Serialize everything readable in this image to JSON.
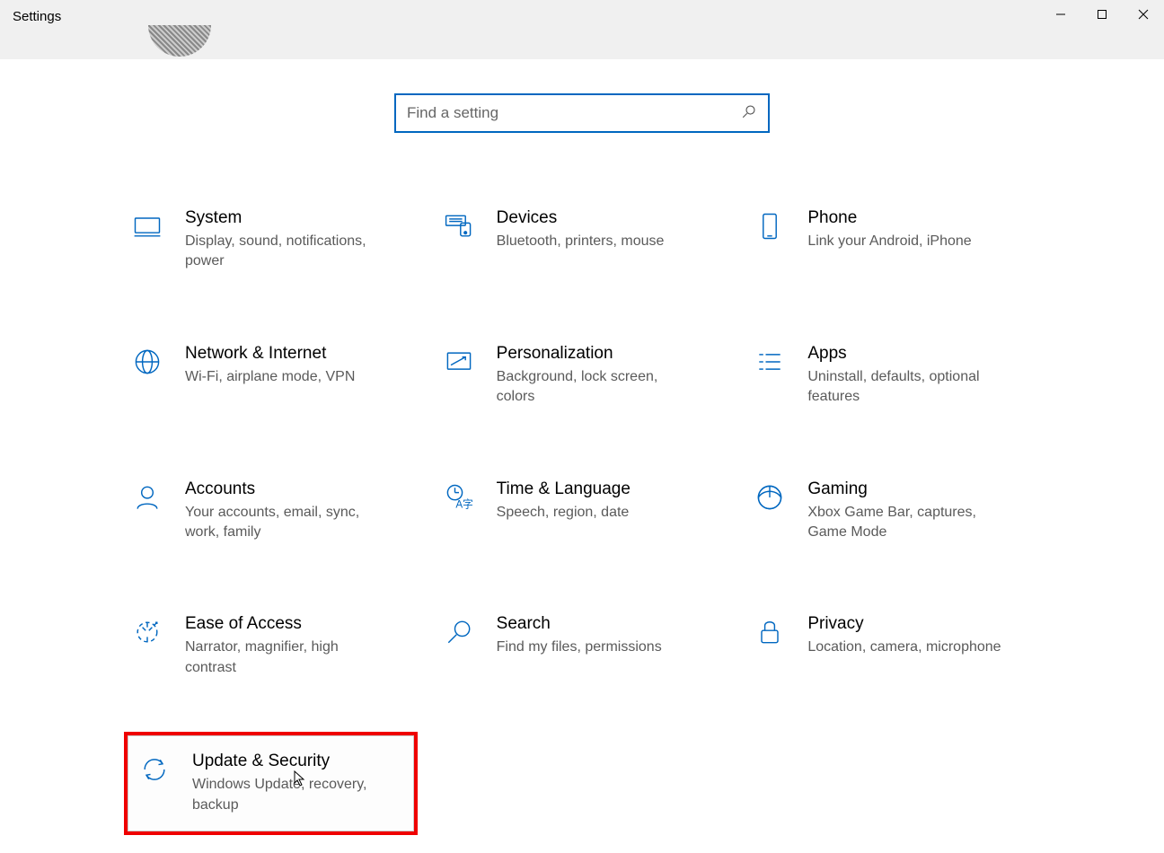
{
  "window": {
    "title": "Settings",
    "minimize": "—",
    "maximize": "☐",
    "close": "✕"
  },
  "search": {
    "placeholder": "Find a setting"
  },
  "categories": [
    {
      "icon": "system",
      "title": "System",
      "desc": "Display, sound, notifications, power"
    },
    {
      "icon": "devices",
      "title": "Devices",
      "desc": "Bluetooth, printers, mouse"
    },
    {
      "icon": "phone",
      "title": "Phone",
      "desc": "Link your Android, iPhone"
    },
    {
      "icon": "network",
      "title": "Network & Internet",
      "desc": "Wi-Fi, airplane mode, VPN"
    },
    {
      "icon": "personal",
      "title": "Personalization",
      "desc": "Background, lock screen, colors"
    },
    {
      "icon": "apps",
      "title": "Apps",
      "desc": "Uninstall, defaults, optional features"
    },
    {
      "icon": "accounts",
      "title": "Accounts",
      "desc": "Your accounts, email, sync, work, family"
    },
    {
      "icon": "time",
      "title": "Time & Language",
      "desc": "Speech, region, date"
    },
    {
      "icon": "gaming",
      "title": "Gaming",
      "desc": "Xbox Game Bar, captures, Game Mode"
    },
    {
      "icon": "ease",
      "title": "Ease of Access",
      "desc": "Narrator, magnifier, high contrast"
    },
    {
      "icon": "search",
      "title": "Search",
      "desc": "Find my files, permissions"
    },
    {
      "icon": "privacy",
      "title": "Privacy",
      "desc": "Location, camera, microphone"
    },
    {
      "icon": "update",
      "title": "Update & Security",
      "desc": "Windows Update, recovery, backup",
      "highlight": true
    }
  ]
}
